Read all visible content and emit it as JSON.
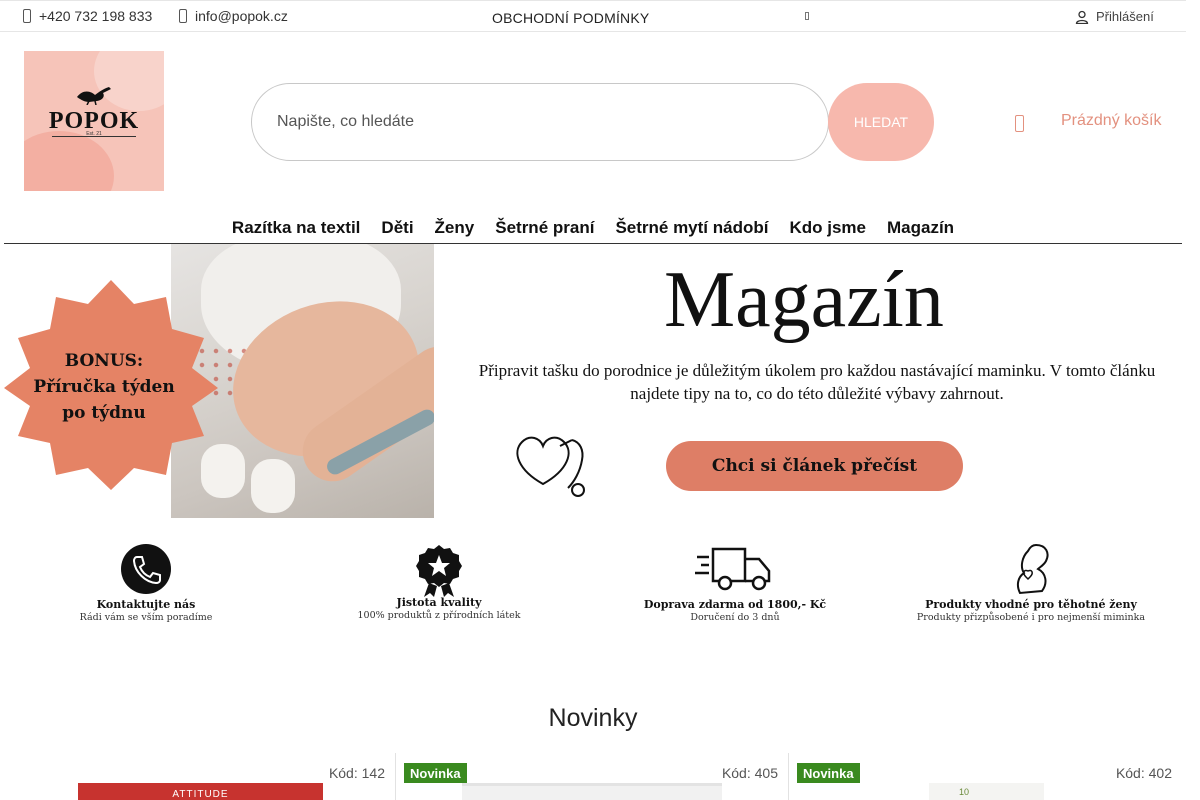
{
  "topbar": {
    "phone": "+420 732 198 833",
    "email": "info@popok.cz",
    "terms": "OBCHODNÍ PODMÍNKY",
    "login": "Přihlášení"
  },
  "logo": {
    "brand": "POPOK",
    "est": "Est. 21"
  },
  "search": {
    "placeholder": "Napište, co hledáte",
    "button": "HLEDAT"
  },
  "cart": {
    "label": "Prázdný košík"
  },
  "nav": [
    {
      "label": "Razítka na textil"
    },
    {
      "label": "Děti"
    },
    {
      "label": "Ženy"
    },
    {
      "label": "Šetrné praní"
    },
    {
      "label": "Šetrné mytí nádobí"
    },
    {
      "label": "Kdo jsme"
    },
    {
      "label": "Magazín"
    }
  ],
  "banner": {
    "badge_lines": [
      "BONUS:",
      "Příručka týden",
      "po týdnu"
    ],
    "title": "Magazín",
    "text": "Připravit tašku do porodnice je důležitým úkolem pro každou nastávající maminku. V tomto článku najdete tipy na to, co do této důležité výbavy zahrnout.",
    "button": "Chci si článek přečíst"
  },
  "features": [
    {
      "title": "Kontaktujte nás",
      "subtitle": "Rádi vám se vším poradíme",
      "icon": "phone-icon"
    },
    {
      "title": "Jistota kvality",
      "subtitle": "100% produktů z přírodních látek",
      "icon": "quality-badge-icon"
    },
    {
      "title": "Doprava zdarma od 1800,- Kč",
      "subtitle": "Doručení do 3 dnů",
      "icon": "delivery-truck-icon"
    },
    {
      "title": "Produkty vhodné pro těhotné ženy",
      "subtitle": "Produkty přizpůsobené i pro nejmenší miminka",
      "icon": "pregnant-woman-icon"
    }
  ],
  "products": {
    "title": "Novinky",
    "items": [
      {
        "tag": "",
        "code": "Kód: 142",
        "thumb_text": "ATTITUDE"
      },
      {
        "tag": "Novinka",
        "code": "Kód: 405",
        "thumb_text": ""
      },
      {
        "tag": "Novinka",
        "code": "Kód: 402",
        "thumb_text": "10"
      }
    ]
  },
  "colors": {
    "accent": "#f7b8ad",
    "cart": "#e3917f",
    "badge": "#e58365",
    "new_tag": "#3a8a1f"
  }
}
